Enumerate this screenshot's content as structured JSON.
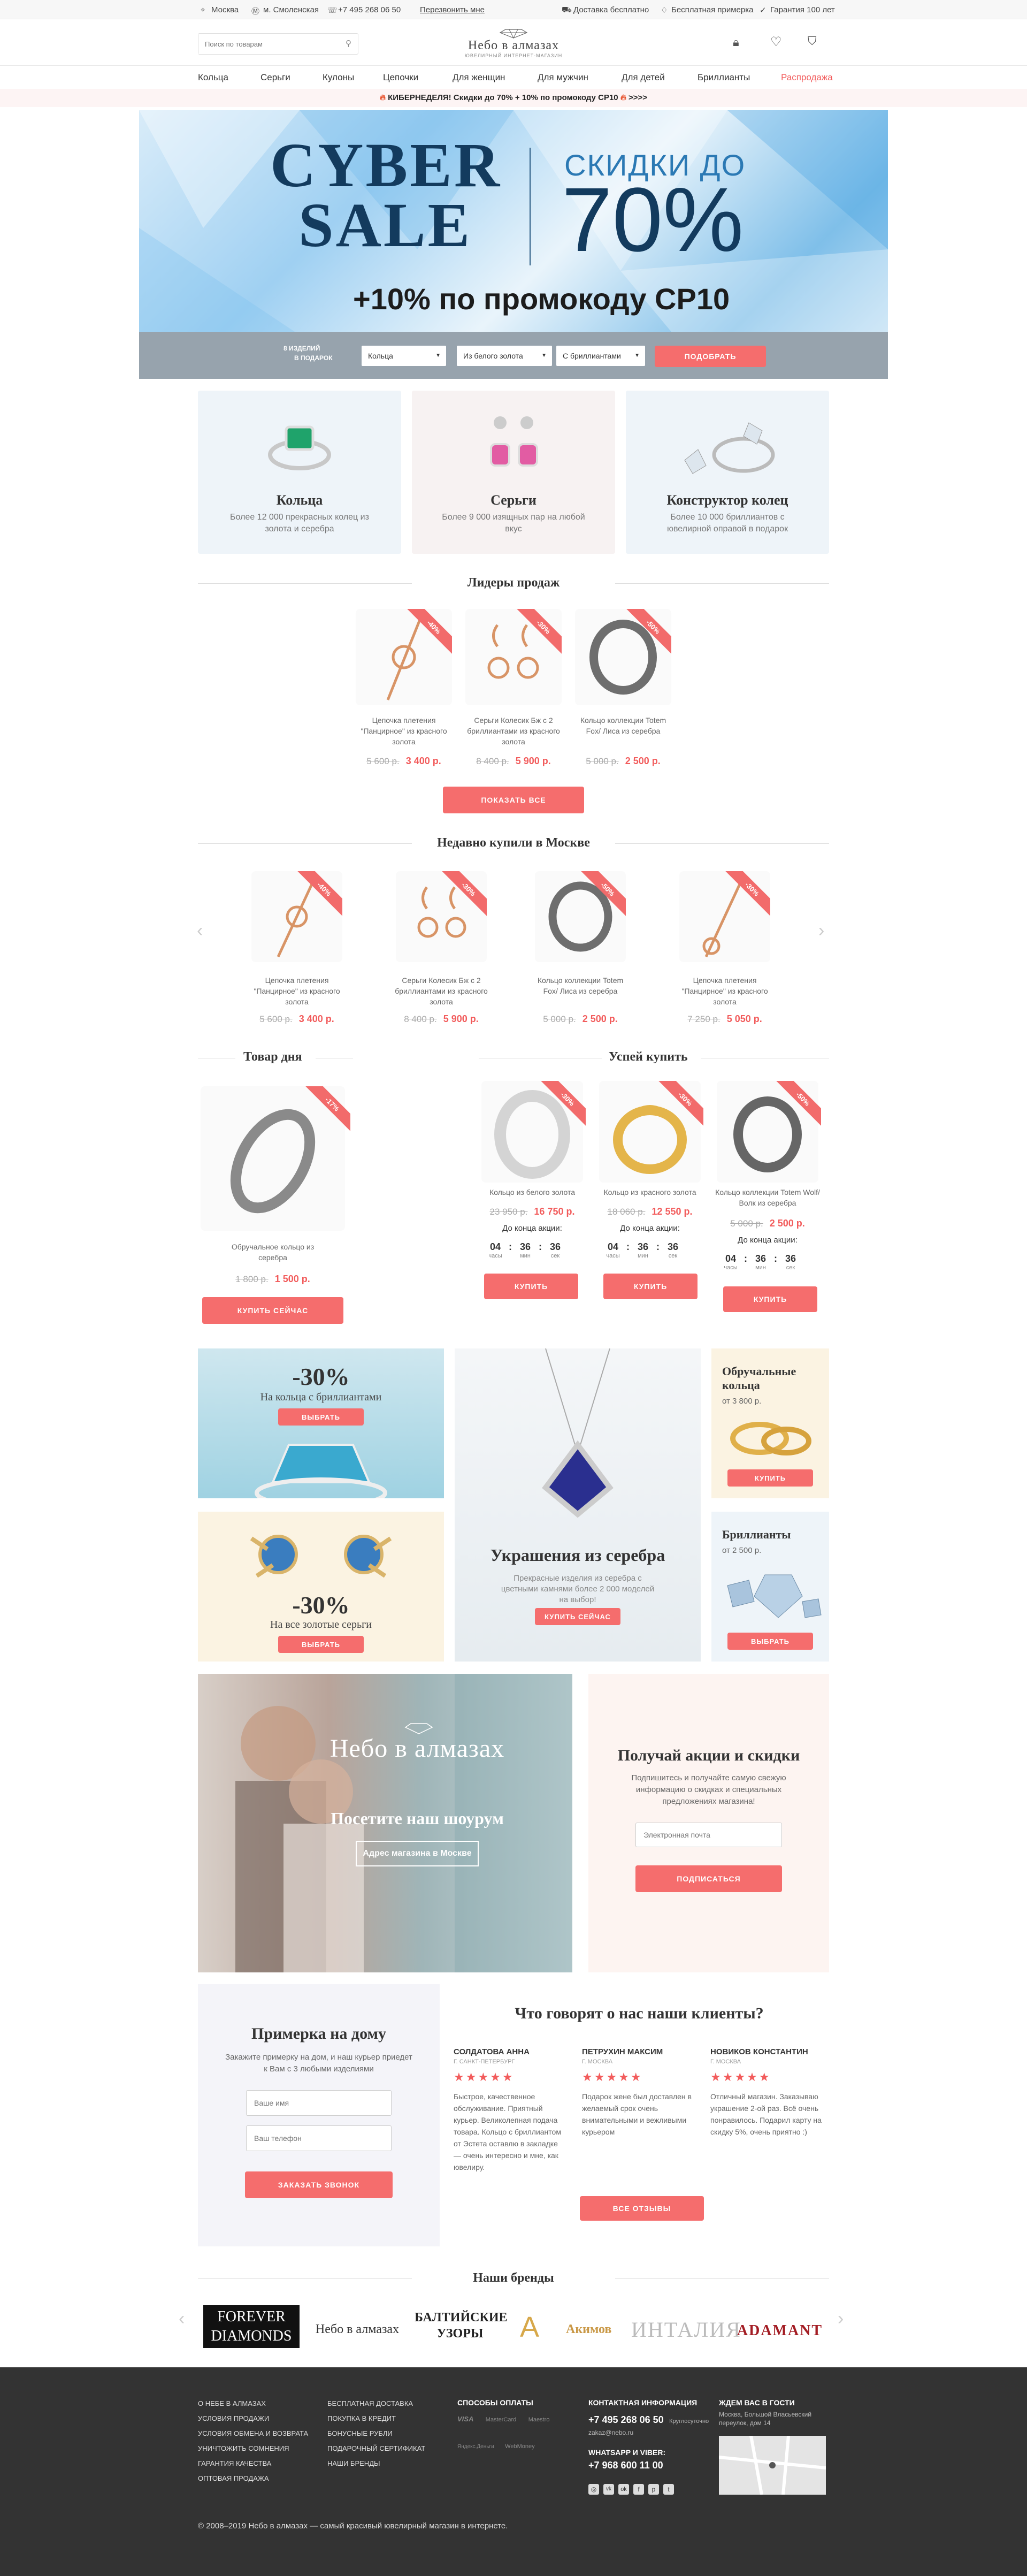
{
  "topbar": {
    "city": "Москва",
    "metro": "м. Смоленская",
    "phone": "+7 495 268 06 50",
    "callback": "Перезвонить мне",
    "delivery": "Доставка бесплатно",
    "fitting": "Бесплатная примерка",
    "warranty": "Гарантия 100 лет"
  },
  "header": {
    "search_placeholder": "Поиск по товарам",
    "logo": "Небо в алмазах",
    "logo_sub": "ЮВЕЛИРНЫЙ ИНТЕРНЕТ-МАГАЗИН"
  },
  "nav": [
    "Кольца",
    "Серьги",
    "Кулоны",
    "Цепочки",
    "Для женщин",
    "Для мужчин",
    "Для детей",
    "Бриллианты",
    "Распродажа"
  ],
  "promo_strip": "КИБЕРНЕДЕЛЯ! Скидки до 70% + 10% по промокоду CP10",
  "promo_strip_tail": ">>>>",
  "hero": {
    "t1": "CYBER",
    "t2": "SALE",
    "s1": "СКИДКИ ДО",
    "s2": "70%",
    "promo": "+10% по промокоду CP10",
    "filter_label1": "8 ИЗДЕЛИЙ",
    "filter_label2": "В ПОДАРОК",
    "filter1": "Кольца",
    "filter2": "Из белого золота",
    "filter3": "С бриллиантами",
    "button": "ПОДОБРАТЬ"
  },
  "categories": [
    {
      "title": "Кольца",
      "desc": "Более 12 000 прекрасных колец из золота и серебра"
    },
    {
      "title": "Серьги",
      "desc": "Более 9 000 изящных пар на любой вкус"
    },
    {
      "title": "Конструктор колец",
      "desc": "Более 10 000 бриллиантов с ювелирной оправой в подарок"
    }
  ],
  "bestsellers": {
    "title": "Лидеры продаж",
    "button": "ПОКАЗАТЬ ВСЕ",
    "items": [
      {
        "name": "Цепочка плетения \"Панцирное\" из красного золота",
        "old": "5 600 р.",
        "new": "3 400 р.",
        "badge": "-40%"
      },
      {
        "name": "Серьги Колесик Бж с 2 бриллиантами из красного золота",
        "old": "8 400 р.",
        "new": "5 900 р.",
        "badge": "-30%"
      },
      {
        "name": "Кольцо коллекции Totem Fox/ Лиса из серебра",
        "old": "5 000 р.",
        "new": "2 500 р.",
        "badge": "-50%"
      }
    ]
  },
  "recent": {
    "title": "Недавно купили в Москве",
    "items": [
      {
        "name": "Цепочка плетения \"Панцирное\" из красного золота",
        "old": "5 600 р.",
        "new": "3 400 р.",
        "badge": "-40%"
      },
      {
        "name": "Серьги Колесик Бж с 2 бриллиантами из красного золота",
        "old": "8 400 р.",
        "new": "5 900 р.",
        "badge": "-30%"
      },
      {
        "name": "Кольцо коллекции Totem Fox/ Лиса из серебра",
        "old": "5 000 р.",
        "new": "2 500 р.",
        "badge": "-50%"
      },
      {
        "name": "Цепочка плетения \"Панцирное\" из красного золота",
        "old": "7 250 р.",
        "new": "5 050 р.",
        "badge": "-30%"
      }
    ]
  },
  "deal": {
    "title": "Товар дня",
    "name": "Обручальное кольцо из серебра",
    "old": "1 800 р.",
    "new": "1 500 р.",
    "badge": "-17%",
    "button": "КУПИТЬ СЕЙЧАС"
  },
  "hurry": {
    "title": "Успей купить",
    "countdown_label": "До конца акции:",
    "units": [
      "часы",
      "мин",
      "сек"
    ],
    "button": "КУПИТЬ",
    "items": [
      {
        "name": "Кольцо из белого золота",
        "old": "23 950 р.",
        "new": "16 750 р.",
        "badge": "-30%",
        "t": [
          "04",
          "36",
          "36"
        ]
      },
      {
        "name": "Кольцо из красного золота",
        "old": "18 060 р.",
        "new": "12 550 р.",
        "badge": "-30%",
        "t": [
          "04",
          "36",
          "36"
        ]
      },
      {
        "name": "Кольцо коллекции Totem Wolf/Волк из серебра",
        "old": "5 000 р.",
        "new": "2 500 р.",
        "badge": "-50%",
        "t": [
          "04",
          "36",
          "36"
        ]
      }
    ]
  },
  "banners": {
    "b1": {
      "pct": "-30%",
      "sub": "На кольца с бриллиантами",
      "btn": "ВЫБРАТЬ"
    },
    "b2": {
      "pct": "-30%",
      "sub": "На все золотые серьги",
      "btn": "ВЫБРАТЬ"
    },
    "b3": {
      "title": "Украшения из серебра",
      "sub": "Прекрасные изделия из серебра с цветными камнями более 2 000 моделей на выбор!",
      "btn": "КУПИТЬ СЕЙЧАС"
    },
    "b4": {
      "title": "Обручальные кольца",
      "sub": "от 3 800 р.",
      "btn": "КУПИТЬ"
    },
    "b5": {
      "title": "Бриллианты",
      "sub": "от 2 500 р.",
      "btn": "ВЫБРАТЬ"
    }
  },
  "showroom": {
    "logo": "Небо в алмазах",
    "title": "Посетите наш шоурум",
    "btn": "Адрес магазина в Москве"
  },
  "subscribe": {
    "title": "Получай акции и скидки",
    "desc": "Подпишитесь и получайте самую свежую информацию о скидках и специальных предложениях магазина!",
    "placeholder": "Электронная почта",
    "btn": "ПОДПИСАТЬСЯ"
  },
  "home": {
    "title": "Примерка на дому",
    "desc": "Закажите примерку на дом, и наш курьер приедет к Вам с 3 любыми изделиями",
    "ph_name": "Ваше имя",
    "ph_phone": "Ваш телефон",
    "btn": "ЗАКАЗАТЬ ЗВОНОК"
  },
  "reviews": {
    "title": "Что говорят о нас наши клиенты?",
    "btn": "ВСЕ ОТЗЫВЫ",
    "items": [
      {
        "name": "Солдатова Анна",
        "city": "г. Санкт-Петербург",
        "stars": "★★★★★",
        "text": "Быстрое, качественное обслуживание. Приятный курьер. Великолепная подача товара. Кольцо с бриллиантом от Эстета оставлю в закладке — очень интересно и мне, как ювелиру."
      },
      {
        "name": "Петрухин Максим",
        "city": "г. Москва",
        "stars": "★★★★★",
        "text": "Подарок жене был доставлен в желаемый срок очень внимательными и вежливыми курьером"
      },
      {
        "name": "Новиков Константин",
        "city": "г. Москва",
        "stars": "★★★★★",
        "text": "Отличный магазин. Заказываю украшение 2-ой раз. Всё очень понравилось. Подарил карту на скидку 5%, очень приятно :)"
      }
    ]
  },
  "brands": {
    "title": "Наши бренды",
    "items": [
      "FOREVER DIAMONDS",
      "Небо в алмазах",
      "БАЛТИЙСКИЕ УЗОРЫ",
      "Акимов",
      "ИНТАЛИЯ",
      "ADAMANT"
    ]
  },
  "footer": {
    "col1": [
      "О небе в алмазах",
      "Условия продажи",
      "Условия обмена и возврата",
      "Уничтожить сомнения",
      "Гарантия качества",
      "Оптовая продажа"
    ],
    "col2": [
      "Бесплатная доставка",
      "Покупка в кредит",
      "Бонусные рубли",
      "Подарочный сертификат",
      "Наши бренды"
    ],
    "pay_title": "Способы оплаты",
    "pay": [
      "VISA",
      "MasterCard",
      "Maestro",
      "Яндекс.Деньги",
      "WebMoney"
    ],
    "contact_title": "Контактная информация",
    "phone": "+7 495 268 06 50",
    "phone_note": "Круглосуточно",
    "email": "zakaz@nebo.ru",
    "wa_title": "WhatsApp и Viber:",
    "wa_phone": "+7 968 600 11 00",
    "visit_title": "Ждем вас в гости",
    "address": "Москва, Большой Власьевский переулок, дом 14",
    "copyright": "© 2008–2019 Небо в алмазах — самый красивый ювелирный магазин в интернете."
  }
}
